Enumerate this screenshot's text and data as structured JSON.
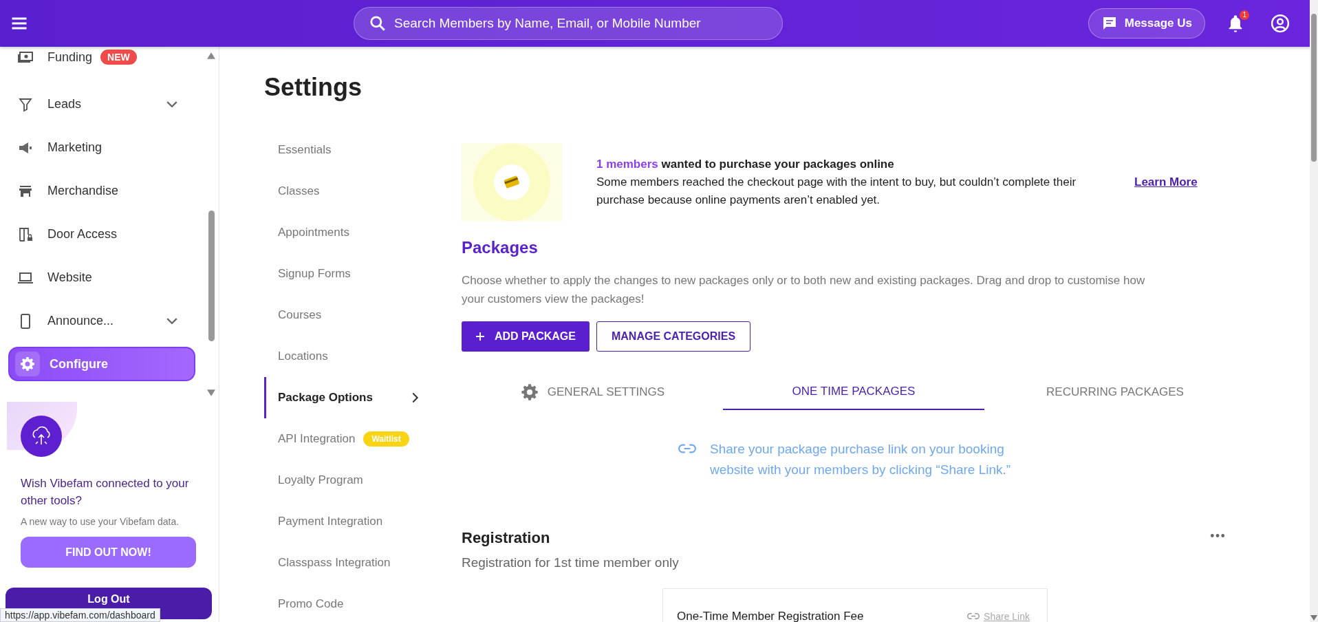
{
  "header": {
    "search_placeholder": "Search Members by Name, Email, or Mobile Number",
    "message_button": "Message Us",
    "notification_count": "1"
  },
  "sidebar": {
    "items": [
      {
        "label": "Funding",
        "badge": "NEW",
        "expandable": false,
        "selected": false
      },
      {
        "label": "Leads",
        "expandable": true,
        "selected": false
      },
      {
        "label": "Marketing",
        "expandable": false,
        "selected": false
      },
      {
        "label": "Merchandise",
        "expandable": false,
        "selected": false
      },
      {
        "label": "Door Access",
        "expandable": false,
        "selected": false
      },
      {
        "label": "Website",
        "expandable": false,
        "selected": false
      },
      {
        "label": "Announce...",
        "expandable": true,
        "selected": false
      },
      {
        "label": "Configure",
        "expandable": false,
        "selected": true
      }
    ],
    "promo": {
      "title": "Wish Vibefam connected to your other tools?",
      "text": "A new way to use your Vibefam data.",
      "button": "FIND OUT NOW!"
    },
    "logout": "Log Out"
  },
  "page_title": "Settings",
  "settings_nav": [
    {
      "label": "Essentials",
      "selected": false
    },
    {
      "label": "Classes",
      "selected": false
    },
    {
      "label": "Appointments",
      "selected": false
    },
    {
      "label": "Signup Forms",
      "selected": false
    },
    {
      "label": "Courses",
      "selected": false
    },
    {
      "label": "Locations",
      "selected": false
    },
    {
      "label": "Package Options",
      "selected": true
    },
    {
      "label": "API Integration",
      "badge": "Waitlist",
      "selected": false
    },
    {
      "label": "Loyalty Program",
      "selected": false
    },
    {
      "label": "Payment Integration",
      "selected": false
    },
    {
      "label": "Classpass Integration",
      "selected": false
    },
    {
      "label": "Promo Code",
      "selected": false
    }
  ],
  "banner": {
    "count": "1 members",
    "title": "wanted to purchase your packages online",
    "text": "Some members reached the checkout page with the intent to buy, but couldn’t complete their purchase because online payments aren’t enabled yet.",
    "link": "Learn More"
  },
  "packages": {
    "title": "Packages",
    "description": "Choose whether to apply the changes to new packages only or to both new and existing packages. Drag and drop to customise how your customers view the packages!",
    "add_button": "ADD PACKAGE",
    "manage_button": "MANAGE CATEGORIES"
  },
  "tabs": [
    {
      "label": "GENERAL SETTINGS",
      "selected": false
    },
    {
      "label": "ONE TIME PACKAGES",
      "selected": true
    },
    {
      "label": "RECURRING PACKAGES",
      "selected": false
    }
  ],
  "share_hint": "Share your package purchase link on your booking website with your members by clicking “Share Link.”",
  "registration": {
    "title": "Registration",
    "subtitle": "Registration for 1st time member only",
    "items": [
      {
        "name": "One-Time Member Registration Fee",
        "link": "Share Link"
      }
    ]
  },
  "status_url": "https://app.vibefam.com/dashboard"
}
